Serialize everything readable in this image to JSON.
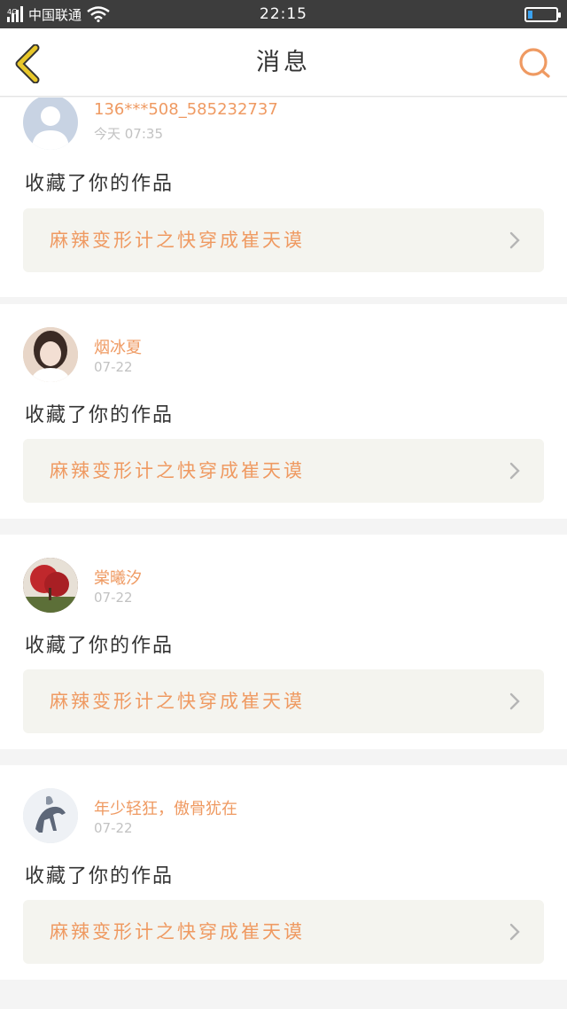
{
  "status_bar": {
    "network": "4G",
    "carrier": "中国联通",
    "time": "22:15",
    "battery_level": 0.15,
    "battery_color": "#3aa2f0"
  },
  "header": {
    "title": "消息",
    "back_icon": "chevron-left-icon",
    "search_icon": "search-icon",
    "accent_color": "#ef9a62",
    "back_color": "#e8c72a"
  },
  "notifications": [
    {
      "username": "136***508_585232737",
      "time": "今天 07:35",
      "action": "收藏了你的作品",
      "work_title": "麻辣变形计之快穿成崔天谟",
      "avatar": "default-avatar"
    },
    {
      "username": "烟冰夏",
      "time": "07-22",
      "action": "收藏了你的作品",
      "work_title": "麻辣变形计之快穿成崔天谟",
      "avatar": "girl-portrait"
    },
    {
      "username": "棠曦汐",
      "time": "07-22",
      "action": "收藏了你的作品",
      "work_title": "麻辣变形计之快穿成崔天谟",
      "avatar": "red-tree"
    },
    {
      "username": "年少轻狂，傲骨犹在",
      "time": "07-22",
      "action": "收藏了你的作品",
      "work_title": "麻辣变形计之快穿成崔天谟",
      "avatar": "ink-horse"
    }
  ]
}
